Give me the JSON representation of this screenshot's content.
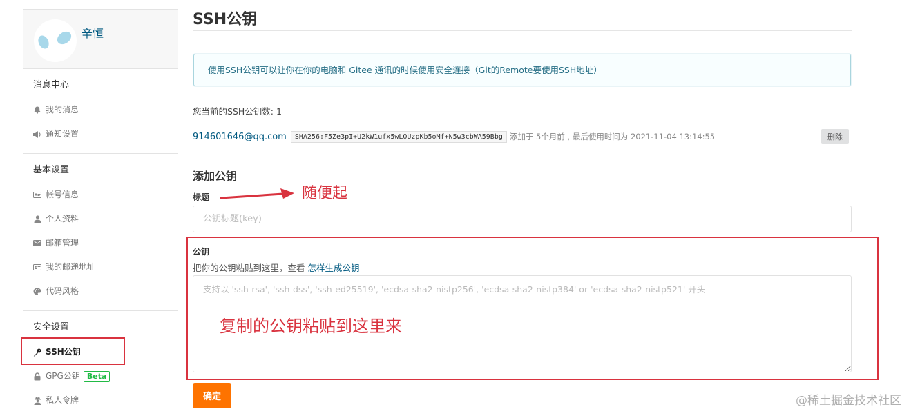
{
  "sidebar": {
    "username": "辛恒",
    "sections": [
      {
        "title": "消息中心",
        "items": [
          {
            "label": "我的消息",
            "icon": "bell-icon"
          },
          {
            "label": "通知设置",
            "icon": "speaker-icon"
          }
        ]
      },
      {
        "title": "基本设置",
        "items": [
          {
            "label": "帐号信息",
            "icon": "id-card-icon"
          },
          {
            "label": "个人资料",
            "icon": "user-icon"
          },
          {
            "label": "邮箱管理",
            "icon": "envelope-icon"
          },
          {
            "label": "我的邮递地址",
            "icon": "address-card-icon"
          },
          {
            "label": "代码风格",
            "icon": "palette-icon"
          }
        ]
      },
      {
        "title": "安全设置",
        "items": [
          {
            "label": "SSH公钥",
            "icon": "key-icon",
            "active": true
          },
          {
            "label": "GPG公钥",
            "icon": "lock-icon",
            "badge": "Beta"
          },
          {
            "label": "私人令牌",
            "icon": "user-secret-icon"
          }
        ]
      }
    ]
  },
  "main": {
    "title": "SSH公钥",
    "info": "使用SSH公钥可以让你在你的电脑和 Gitee 通讯的时候使用安全连接（Git的Remote要使用SSH地址）",
    "count_text": "您当前的SSH公钥数: 1",
    "keys": [
      {
        "email": "914601646@qq.com",
        "fingerprint": "SHA256:F5Ze3pI+U2kW1ufx5wLOUzpKb5oMf+N5w3cbWA59Bbg",
        "meta": "添加于 5个月前 , 最后使用时间为 2021-11-04 13:14:55",
        "delete_label": "删除"
      }
    ],
    "add_title": "添加公钥",
    "title_label": "标题",
    "title_placeholder": "公钥标题(key)",
    "key_label": "公钥",
    "key_hint": "把你的公钥粘贴到这里，查看 ",
    "key_hint_link": "怎样生成公钥",
    "key_placeholder": "支持以 'ssh-rsa', 'ssh-dss', 'ssh-ed25519', 'ecdsa-sha2-nistp256', 'ecdsa-sha2-nistp384' or 'ecdsa-sha2-nistp521' 开头",
    "submit_label": "确定"
  },
  "annotations": {
    "title_note": "随便起",
    "key_note": "复制的公钥粘贴到这里来",
    "color": "#d9333f"
  },
  "watermark": "@稀土掘金技术社区",
  "colors": {
    "accent": "#fe7300",
    "link": "#005980",
    "info_bg": "#f8feff",
    "beta": "#21ba45"
  }
}
